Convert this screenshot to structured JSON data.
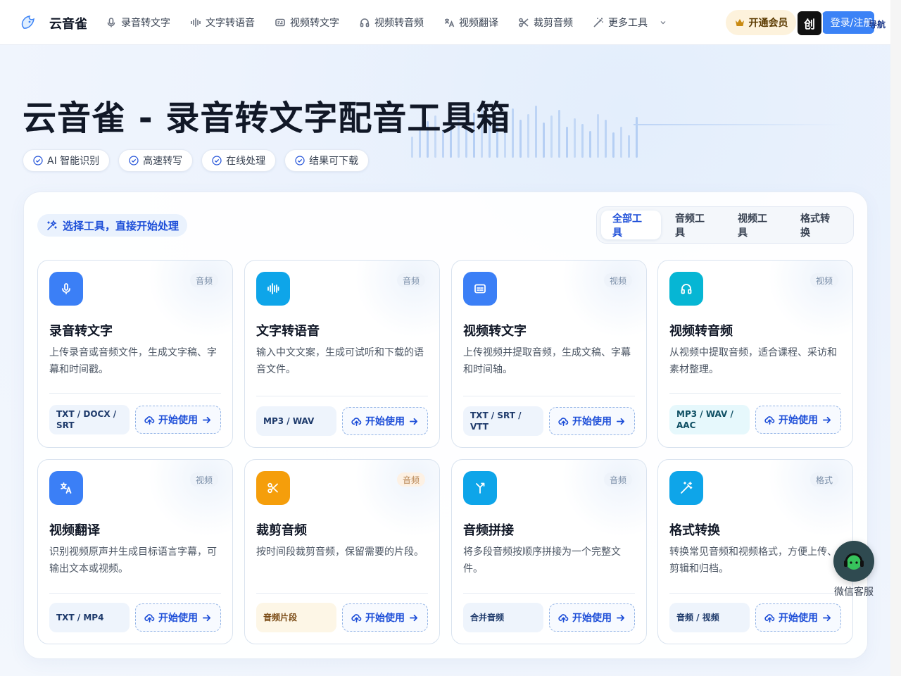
{
  "brand": {
    "name": "云音雀"
  },
  "nav": {
    "items": [
      {
        "label": "录音转文字",
        "icon": "mic-icon"
      },
      {
        "label": "文字转语音",
        "icon": "waveform-icon"
      },
      {
        "label": "视频转文字",
        "icon": "subtitle-icon"
      },
      {
        "label": "视频转音频",
        "icon": "video-audio-icon"
      },
      {
        "label": "视频翻译",
        "icon": "translate-icon"
      },
      {
        "label": "裁剪音频",
        "icon": "scissors-icon"
      },
      {
        "label": "更多工具",
        "icon": "magic-wand-icon"
      }
    ],
    "vip_label": "开通会员",
    "login_label": "登录/注册",
    "app_badge": "创",
    "corner_text": "导航"
  },
  "hero": {
    "title": "云音雀 - 录音转文字配音工具箱",
    "chips": [
      "AI 智能识别",
      "高速转写",
      "在线处理",
      "结果可下载"
    ]
  },
  "panel": {
    "tag": "选择工具，直接开始处理",
    "tabs": [
      "全部工具",
      "音频工具",
      "视频工具",
      "格式转换"
    ],
    "active_tab": "全部工具"
  },
  "cards": [
    {
      "title": "录音转文字",
      "badge": "音频",
      "desc": "上传录音或音频文件，生成文字稿、字幕和时间戳。",
      "formats": "TXT / DOCX / SRT",
      "button": "开始使用",
      "icon": "mic-icon",
      "color": "#3b7ff6"
    },
    {
      "title": "文字转语音",
      "badge": "音频",
      "desc": "输入中文文案，生成可试听和下载的语音文件。",
      "formats": "MP3 / WAV",
      "button": "开始使用",
      "icon": "waveform-icon",
      "color": "#0ea5e9"
    },
    {
      "title": "视频转文字",
      "badge": "视频",
      "desc": "上传视频并提取音频，生成文稿、字幕和时间轴。",
      "formats": "TXT / SRT / VTT",
      "button": "开始使用",
      "icon": "subtitle-icon",
      "color": "#3b7ff6"
    },
    {
      "title": "视频转音频",
      "badge": "视频",
      "desc": "从视频中提取音频，适合课程、采访和素材整理。",
      "formats": "MP3 / WAV / AAC",
      "button": "开始使用",
      "icon": "video-audio-icon",
      "color": "#06b6d4"
    },
    {
      "title": "视频翻译",
      "badge": "视频",
      "desc": "识别视频原声并生成目标语言字幕，可输出文本或视频。",
      "formats": "TXT / MP4",
      "button": "开始使用",
      "icon": "translate-icon",
      "color": "#3b7ff6"
    },
    {
      "title": "裁剪音频",
      "badge": "音频",
      "desc": "按时间段裁剪音频，保留需要的片段。",
      "formats": "音频片段",
      "button": "开始使用",
      "icon": "scissors-icon",
      "color": "#f59e0b"
    },
    {
      "title": "音频拼接",
      "badge": "音频",
      "desc": "将多段音频按顺序拼接为一个完整文件。",
      "formats": "合并音频",
      "button": "开始使用",
      "icon": "merge-icon",
      "color": "#0ea5e9"
    },
    {
      "title": "格式转换",
      "badge": "格式",
      "desc": "转换常见音频和视频格式，方便上传、剪辑和归档。",
      "formats": "音频 / 视频",
      "button": "开始使用",
      "icon": "magic-wand-icon",
      "color": "#0ea5e9"
    }
  ],
  "service": {
    "label": "微信客服"
  }
}
